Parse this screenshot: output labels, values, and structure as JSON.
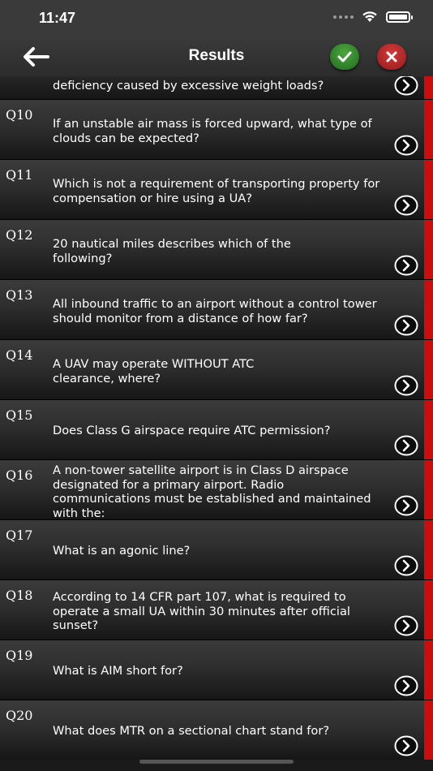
{
  "status_bar": {
    "time": "11:47"
  },
  "nav": {
    "title": "Results"
  },
  "colors": {
    "accent_red": "#cc0d0d",
    "accept_green": "#2e7d27",
    "reject_red": "#a82424"
  },
  "questions": [
    {
      "number": "",
      "text": "deficiency caused by excessive weight loads?"
    },
    {
      "number": "Q10",
      "text": "If an unstable air mass is forced upward, what type of clouds can be expected?"
    },
    {
      "number": "Q11",
      "text": "Which is not a requirement of transporting property for compensation or hire using a UA?"
    },
    {
      "number": "Q12",
      "text": "20 nautical miles describes which of the following?"
    },
    {
      "number": "Q13",
      "text": "All inbound traffic to an airport without a control tower should monitor from a distance of how far?"
    },
    {
      "number": "Q14",
      "text": "A UAV may operate WITHOUT ATC clearance, where?"
    },
    {
      "number": "Q15",
      "text": "Does Class G airspace require ATC permission?"
    },
    {
      "number": "Q16",
      "text": "A non-tower satellite airport is in Class D airspace designated for a primary airport. Radio communications must be established and maintained with the:"
    },
    {
      "number": "Q17",
      "text": "What is an agonic line?"
    },
    {
      "number": "Q18",
      "text": "According to 14 CFR part 107, what is required to operate a small UA within 30 minutes after official sunset?"
    },
    {
      "number": "Q19",
      "text": "What is AIM short for?"
    },
    {
      "number": "Q20",
      "text": "What does MTR on a sectional chart stand for?"
    }
  ]
}
